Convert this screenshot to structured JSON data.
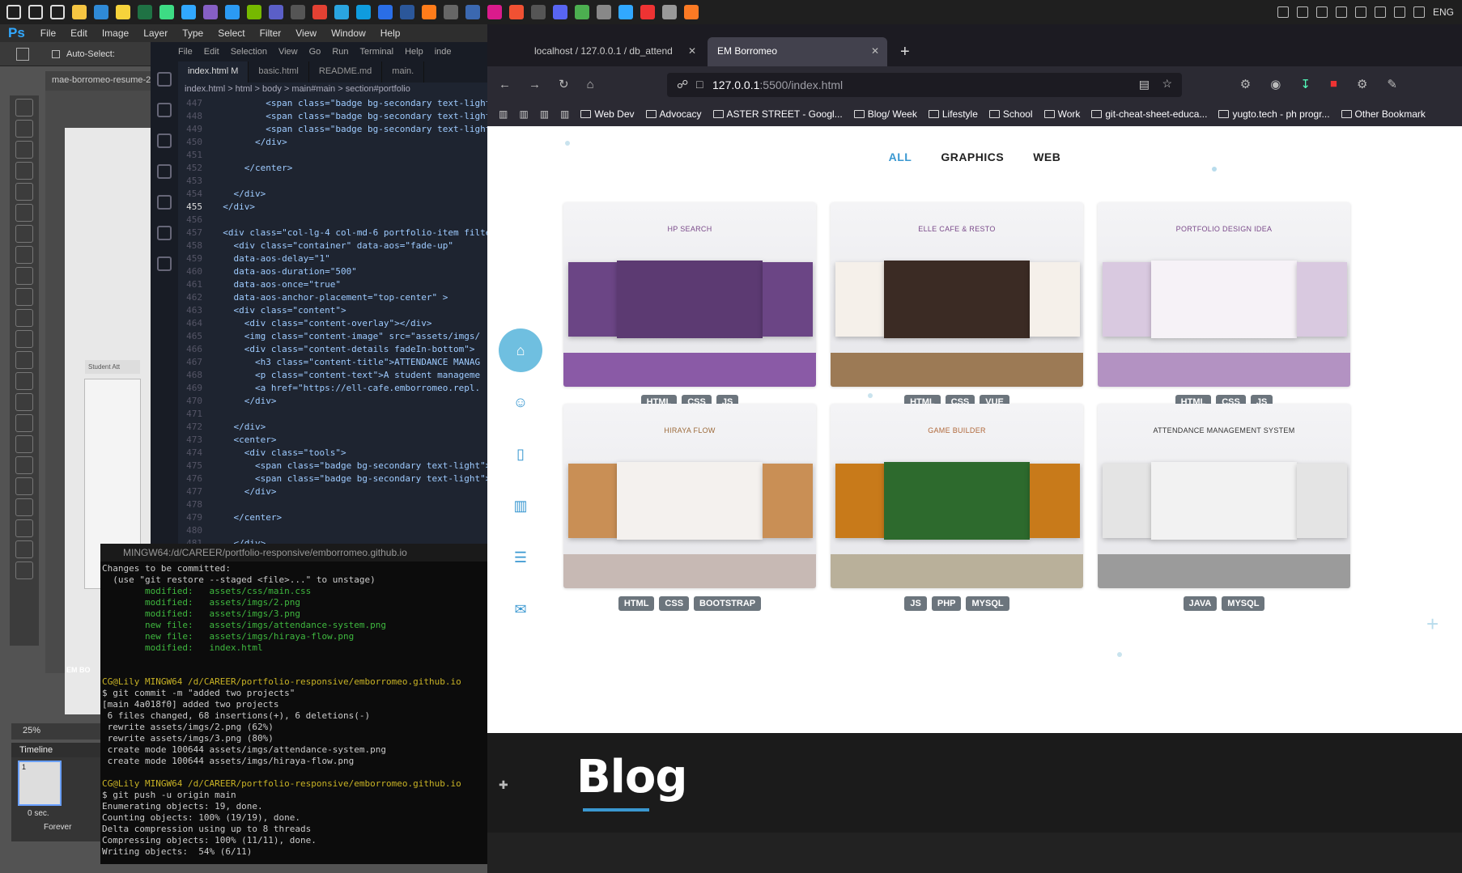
{
  "taskbar": {
    "icons": [
      "windows-icon",
      "search-icon",
      "task-view-icon",
      "file-explorer-icon",
      "mail-icon",
      "sticky-notes-icon",
      "excel-icon",
      "android-studio-icon",
      "photoshop-icon",
      "visual-studio-icon",
      "vscode-icon",
      "nvidia-icon",
      "teams-icon",
      "app-icon",
      "chrome-icon",
      "app-icon",
      "edge-icon",
      "app-icon",
      "word-icon",
      "app-icon",
      "obs-icon",
      "app-icon",
      "app-icon",
      "git-icon",
      "app-icon",
      "discord-icon",
      "app-icon",
      "app-icon",
      "photoshop-icon",
      "app-icon",
      "app-icon",
      "xampp-icon"
    ],
    "tray_lang": "ENG"
  },
  "photoshop": {
    "logo": "Ps",
    "menu": [
      "File",
      "Edit",
      "Image",
      "Layer",
      "Type",
      "Select",
      "Filter",
      "View",
      "Window",
      "Help"
    ],
    "auto_select": "Auto-Select:",
    "doc_tab": "mae-borromeo-resume-2",
    "zoom": "25%",
    "timeline_title": "Timeline",
    "frame_num": "1",
    "frame_delay": "0 sec.",
    "loop": "Forever",
    "canvas_label": "EM BO",
    "student_label": "Student Att"
  },
  "vscode": {
    "menu": [
      "File",
      "Edit",
      "Selection",
      "View",
      "Go",
      "Run",
      "Terminal",
      "Help"
    ],
    "title_suffix": "inde",
    "tabs": [
      {
        "label": "index.html M",
        "active": true
      },
      {
        "label": "basic.html",
        "active": false
      },
      {
        "label": "README.md",
        "active": false
      },
      {
        "label": "main.",
        "active": false
      }
    ],
    "breadcrumb": "index.html > html > body > main#main > section#portfolio",
    "lines": [
      {
        "n": "447",
        "t": "          <span class=\"badge bg-secondary text-light\">"
      },
      {
        "n": "448",
        "t": "          <span class=\"badge bg-secondary text-light\">"
      },
      {
        "n": "449",
        "t": "          <span class=\"badge bg-secondary text-light\">"
      },
      {
        "n": "450",
        "t": "        </div>"
      },
      {
        "n": "451",
        "t": ""
      },
      {
        "n": "452",
        "t": "      </center>"
      },
      {
        "n": "453",
        "t": ""
      },
      {
        "n": "454",
        "t": "    </div>"
      },
      {
        "n": "455",
        "t": "  </div>"
      },
      {
        "n": "456",
        "t": ""
      },
      {
        "n": "457",
        "t": "  <div class=\"col-lg-4 col-md-6 portfolio-item filte"
      },
      {
        "n": "458",
        "t": "    <div class=\"container\" data-aos=\"fade-up\""
      },
      {
        "n": "459",
        "t": "    data-aos-delay=\"1\""
      },
      {
        "n": "460",
        "t": "    data-aos-duration=\"500\""
      },
      {
        "n": "461",
        "t": "    data-aos-once=\"true\""
      },
      {
        "n": "462",
        "t": "    data-aos-anchor-placement=\"top-center\" >"
      },
      {
        "n": "463",
        "t": "    <div class=\"content\">"
      },
      {
        "n": "464",
        "t": "      <div class=\"content-overlay\"></div>"
      },
      {
        "n": "465",
        "t": "      <img class=\"content-image\" src=\"assets/imgs/"
      },
      {
        "n": "466",
        "t": "      <div class=\"content-details fadeIn-bottom\">"
      },
      {
        "n": "467",
        "t": "        <h3 class=\"content-title\">ATTENDANCE MANAG"
      },
      {
        "n": "468",
        "t": "        <p class=\"content-text\">A student manageme"
      },
      {
        "n": "469",
        "t": "        <a href=\"https://ell-cafe.emborromeo.repl."
      },
      {
        "n": "470",
        "t": "      </div>"
      },
      {
        "n": "471",
        "t": ""
      },
      {
        "n": "472",
        "t": "    </div>"
      },
      {
        "n": "473",
        "t": "    <center>"
      },
      {
        "n": "474",
        "t": "      <div class=\"tools\">"
      },
      {
        "n": "475",
        "t": "        <span class=\"badge bg-secondary text-light\">"
      },
      {
        "n": "476",
        "t": "        <span class=\"badge bg-secondary text-light\">"
      },
      {
        "n": "477",
        "t": "      </div>"
      },
      {
        "n": "478",
        "t": ""
      },
      {
        "n": "479",
        "t": "    </center>"
      },
      {
        "n": "480",
        "t": ""
      },
      {
        "n": "481",
        "t": "    </div>"
      }
    ],
    "current_line": "455"
  },
  "terminal": {
    "title": "MINGW64:/d/CAREER/portfolio-responsive/emborromeo.github.io",
    "lines": [
      {
        "c": "",
        "t": "Changes to be committed:"
      },
      {
        "c": "",
        "t": "  (use \"git restore --staged <file>...\" to unstage)"
      },
      {
        "c": "green",
        "t": "        modified:   assets/css/main.css"
      },
      {
        "c": "green",
        "t": "        modified:   assets/imgs/2.png"
      },
      {
        "c": "green",
        "t": "        modified:   assets/imgs/3.png"
      },
      {
        "c": "green",
        "t": "        new file:   assets/imgs/attendance-system.png"
      },
      {
        "c": "green",
        "t": "        new file:   assets/imgs/hiraya-flow.png"
      },
      {
        "c": "green",
        "t": "        modified:   index.html"
      },
      {
        "c": "",
        "t": ""
      },
      {
        "c": "",
        "t": ""
      },
      {
        "c": "yellow",
        "t": "CG@Lily MINGW64 /d/CAREER/portfolio-responsive/emborromeo.github.io"
      },
      {
        "c": "",
        "t": "$ git commit -m \"added two projects\""
      },
      {
        "c": "",
        "t": "[main 4a018f0] added two projects"
      },
      {
        "c": "",
        "t": " 6 files changed, 68 insertions(+), 6 deletions(-)"
      },
      {
        "c": "",
        "t": " rewrite assets/imgs/2.png (62%)"
      },
      {
        "c": "",
        "t": " rewrite assets/imgs/3.png (80%)"
      },
      {
        "c": "",
        "t": " create mode 100644 assets/imgs/attendance-system.png"
      },
      {
        "c": "",
        "t": " create mode 100644 assets/imgs/hiraya-flow.png"
      },
      {
        "c": "",
        "t": ""
      },
      {
        "c": "yellow",
        "t": "CG@Lily MINGW64 /d/CAREER/portfolio-responsive/emborromeo.github.io"
      },
      {
        "c": "",
        "t": "$ git push -u origin main"
      },
      {
        "c": "",
        "t": "Enumerating objects: 19, done."
      },
      {
        "c": "",
        "t": "Counting objects: 100% (19/19), done."
      },
      {
        "c": "",
        "t": "Delta compression using up to 8 threads"
      },
      {
        "c": "",
        "t": "Compressing objects: 100% (11/11), done."
      },
      {
        "c": "",
        "t": "Writing objects:  54% (6/11)"
      }
    ]
  },
  "browser": {
    "tabs": [
      {
        "label": "localhost / 127.0.0.1 / db_attend",
        "active": false
      },
      {
        "label": "EM Borromeo",
        "active": true
      }
    ],
    "url_host": "127.0.0.1",
    "url_rest": ":5500/index.html",
    "bookmarks": [
      "Web Dev",
      "Advocacy",
      "ASTER STREET - Googl...",
      "Blog/ Week",
      "Lifestyle",
      "School",
      "Work",
      "git-cheat-sheet-educa...",
      "yugto.tech - ph progr...",
      "Other Bookmark"
    ]
  },
  "portfolio": {
    "filters": [
      {
        "label": "ALL",
        "active": true
      },
      {
        "label": "GRAPHICS",
        "active": false
      },
      {
        "label": "WEB",
        "active": false
      }
    ],
    "nav_icons": [
      "home-icon",
      "person-icon",
      "document-icon",
      "book-icon",
      "server-icon",
      "mail-icon"
    ],
    "projects": [
      {
        "title": "HP SEARCH",
        "title_color": "#7a4a8a",
        "floor": "#8a5aa6",
        "badges": [
          "HTML",
          "CSS",
          "JS"
        ]
      },
      {
        "title": "ELLE CAFE & RESTO",
        "title_color": "#7a4a8a",
        "floor": "#9c7a55",
        "badges": [
          "HTML",
          "CSS",
          "VUE"
        ]
      },
      {
        "title": "PORTFOLIO DESIGN IDEA",
        "title_color": "#7a4a8a",
        "floor": "#b392c2",
        "badges": [
          "HTML",
          "CSS",
          "JS"
        ]
      },
      {
        "title": "HIRAYA FLOW",
        "title_color": "#9c6a3a",
        "floor": "#c7b9b4",
        "badges": [
          "HTML",
          "CSS",
          "BOOTSTRAP"
        ]
      },
      {
        "title": "GAME BUILDER",
        "title_color": "#b0683a",
        "floor": "#b9b09a",
        "badges": [
          "JS",
          "PHP",
          "MYSQL"
        ]
      },
      {
        "title": "ATTENDANCE MANAGEMENT SYSTEM",
        "title_color": "#333333",
        "floor": "#9b9b9b",
        "badges": [
          "JAVA",
          "MYSQL"
        ]
      }
    ],
    "blog_heading": "Blog"
  },
  "colors": {
    "accent": "#3a98d1",
    "badge": "#6c757d"
  }
}
